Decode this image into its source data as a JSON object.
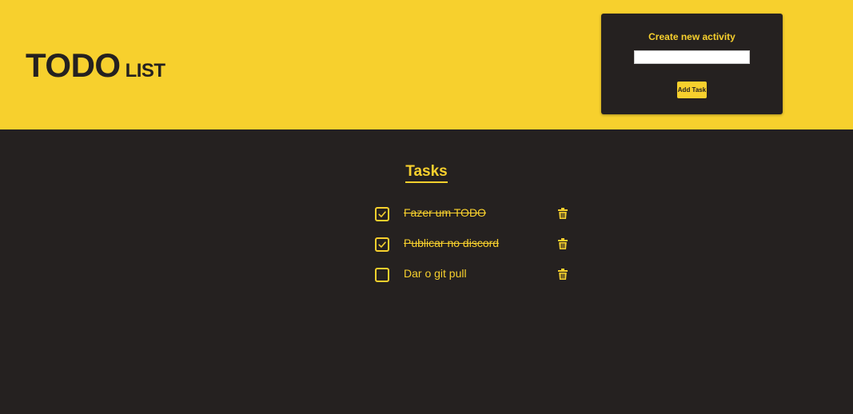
{
  "header": {
    "title_big": "TODO",
    "title_small": "LIST"
  },
  "create": {
    "title": "Create new activity",
    "input_value": "",
    "add_label": "Add Task"
  },
  "tasks_title": "Tasks",
  "tasks": [
    {
      "label": "Fazer um TODO",
      "done": true
    },
    {
      "label": "Publicar no discord",
      "done": true
    },
    {
      "label": "Dar o git pull",
      "done": false
    }
  ],
  "colors": {
    "accent": "#f7d02d",
    "background": "#252120",
    "input_bg": "#ffffff"
  }
}
